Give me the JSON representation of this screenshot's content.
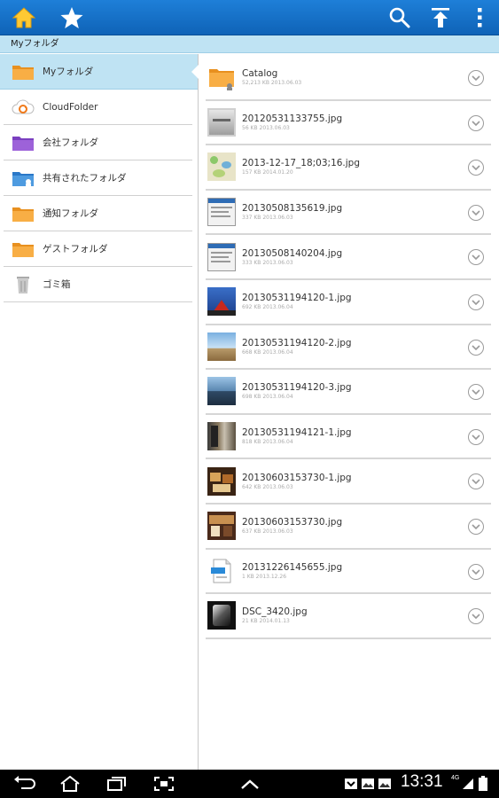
{
  "breadcrumb": "Myフォルダ",
  "sidebar": {
    "items": [
      {
        "label": "Myフォルダ",
        "icon": "folder-orange-icon",
        "active": true
      },
      {
        "label": "CloudFolder",
        "icon": "cloud-sync-icon",
        "active": false
      },
      {
        "label": "会社フォルダ",
        "icon": "folder-purple-icon",
        "active": false
      },
      {
        "label": "共有されたフォルダ",
        "icon": "shared-folder-icon",
        "active": false
      },
      {
        "label": "通知フォルダ",
        "icon": "folder-orange-icon",
        "active": false
      },
      {
        "label": "ゲストフォルダ",
        "icon": "folder-orange-icon",
        "active": false
      },
      {
        "label": "ゴミ箱",
        "icon": "trash-icon",
        "active": false
      }
    ]
  },
  "files": [
    {
      "name": "Catalog",
      "meta": "52,213 KB  2013.06.03",
      "thumb": "folder-shared-icon"
    },
    {
      "name": "20120531133755.jpg",
      "meta": "56 KB  2013.06.03",
      "thumb": "photo-gray"
    },
    {
      "name": "2013-12-17_18;03;16.jpg",
      "meta": "157 KB  2014.01.20",
      "thumb": "photo-map"
    },
    {
      "name": "20130508135619.jpg",
      "meta": "337 KB  2013.06.03",
      "thumb": "photo-screen"
    },
    {
      "name": "20130508140204.jpg",
      "meta": "333 KB  2013.06.03",
      "thumb": "photo-screen"
    },
    {
      "name": "20130531194120-1.jpg",
      "meta": "692 KB  2013.06.04",
      "thumb": "photo-tower"
    },
    {
      "name": "20130531194120-2.jpg",
      "meta": "668 KB  2013.06.04",
      "thumb": "photo-sky"
    },
    {
      "name": "20130531194120-3.jpg",
      "meta": "698 KB  2013.06.04",
      "thumb": "photo-sea"
    },
    {
      "name": "20130531194121-1.jpg",
      "meta": "818 KB  2013.06.04",
      "thumb": "photo-street"
    },
    {
      "name": "20130603153730-1.jpg",
      "meta": "642 KB  2013.06.03",
      "thumb": "photo-food"
    },
    {
      "name": "20130603153730.jpg",
      "meta": "637 KB  2013.06.03",
      "thumb": "photo-room"
    },
    {
      "name": "20131226145655.jpg",
      "meta": "1 KB  2013.12.26",
      "thumb": "file-icon"
    },
    {
      "name": "DSC_3420.jpg",
      "meta": "21 KB  2014.01.13",
      "thumb": "photo-bw"
    }
  ],
  "status_bar": {
    "time": "13:31",
    "network": "4G"
  },
  "colors": {
    "accent": "#1877d0",
    "selection": "#bfe3f3",
    "folder": "#f6a63a"
  }
}
